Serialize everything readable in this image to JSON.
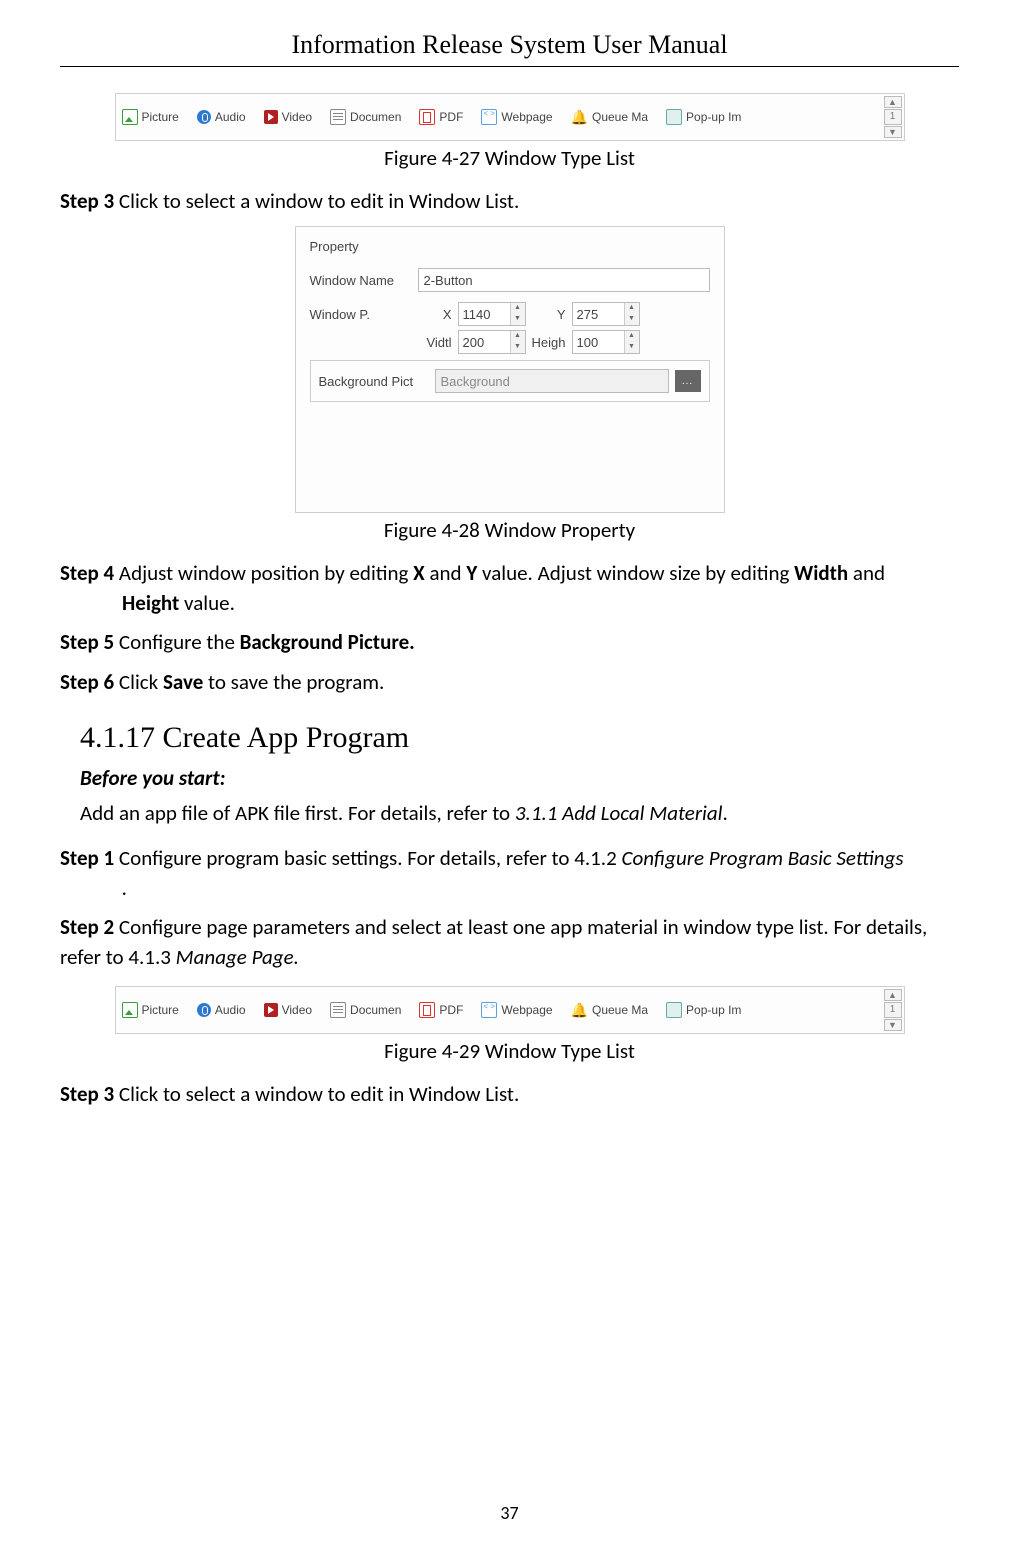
{
  "header": {
    "title": "Information Release System User Manual"
  },
  "page_number": "37",
  "toolbar": {
    "items": [
      {
        "label": "Picture",
        "icon": "picture-icon"
      },
      {
        "label": "Audio",
        "icon": "audio-icon"
      },
      {
        "label": "Video",
        "icon": "video-icon"
      },
      {
        "label": "Documen",
        "icon": "document-icon"
      },
      {
        "label": "PDF",
        "icon": "pdf-icon"
      },
      {
        "label": "Webpage",
        "icon": "webpage-icon"
      },
      {
        "label": "Queue Ma",
        "icon": "queue-icon"
      },
      {
        "label": "Pop-up Im",
        "icon": "popup-icon"
      }
    ],
    "scroll_value": "1"
  },
  "captions": {
    "fig27": "Figure 4-27 Window Type List",
    "fig28": "Figure 4-28 Window Property",
    "fig29": "Figure 4-29 Window Type List"
  },
  "property_panel": {
    "title": "Property",
    "window_name_label": "Window Name",
    "window_name_value": "2-Button",
    "window_p_label": "Window P.",
    "x_label": "X",
    "x_value": "1140",
    "y_label": "Y",
    "y_value": "275",
    "width_label": "Vidtl",
    "width_value": "200",
    "height_label": "Heigh",
    "height_value": "100",
    "bg_label": "Background Pict",
    "bg_placeholder": "Background",
    "bg_btn": "..."
  },
  "steps": {
    "s3a_label": "Step 3",
    "s3a_text": " Click to select a window to edit in Window List.",
    "s4_label": "Step 4",
    "s4_part1": " Adjust window position by editing ",
    "s4_x": "X",
    "s4_and": " and ",
    "s4_y": "Y",
    "s4_part2": " value. Adjust window size by editing ",
    "s4_width": "Width",
    "s4_and2": " and ",
    "s4_height": "Height",
    "s4_part3": " value.",
    "s5_label": "Step 5",
    "s5_text1": " Configure the ",
    "s5_bold": "Background Picture.",
    "s6_label": "Step 6",
    "s6_text1": " Click ",
    "s6_bold": "Save",
    "s6_text2": " to save the program.",
    "s1_label": "Step 1",
    "s1_text1": " Configure program basic settings. For details, refer to 4.1.2 ",
    "s1_italic": "Configure Program Basic Settings",
    "s1_dot": ".",
    "s2_label": "Step 2",
    "s2_text1": " Configure page parameters and select at least one app material in window type list. For details, refer to 4.1.3 ",
    "s2_italic": "Manage Page.",
    "s3b_label": "Step 3",
    "s3b_text": " Click to select a window to edit in Window List."
  },
  "section": {
    "heading": "4.1.17 Create App Program",
    "before": "Before you start:",
    "before_text1": "Add an app file of APK file first. For details, refer to ",
    "before_italic": "3.1.1 Add Local Material",
    "before_dot": "."
  }
}
